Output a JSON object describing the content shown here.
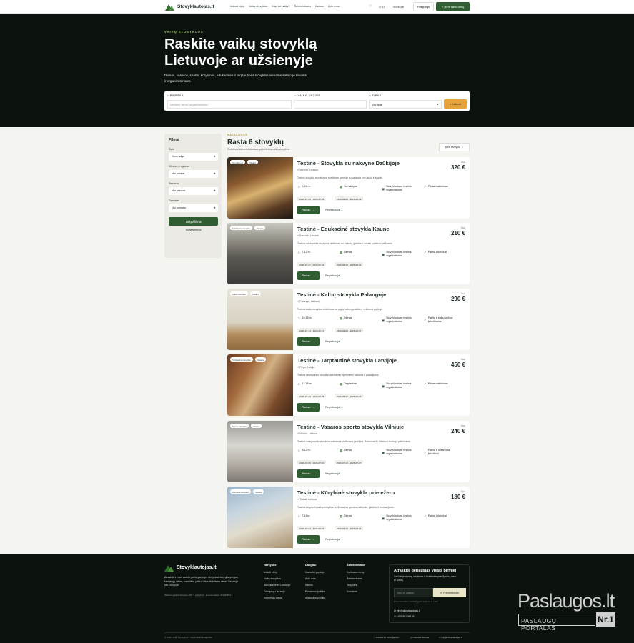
{
  "header": {
    "logo": "Stovyklautojas.lt",
    "nav": [
      "Ieškoti vietų",
      "Vaikų stovyklos",
      "Kaip tai veikia?",
      "Šeimininkams",
      "Kainos",
      "Apie mus"
    ],
    "lang": "LT",
    "search": "Ieškoti",
    "login": "Prisijungti",
    "add": "Įkelti savo vietą"
  },
  "hero": {
    "kicker": "VAIKŲ STOVYKLOS",
    "title": "Raskite vaikų stovyklą Lietuvoje ar užsienyje",
    "subtitle": "Dienos, vasaros, sporto, kūrybinės, edukacinės ir tarptautinės stovyklos viename kataloge tėvams ir organizatoriams.",
    "search": {
      "q_label": "PAIEŠKA",
      "q_placeholder": "Miestas, tema, organizatorius...",
      "age_label": "VAIKO AMŽIUS",
      "type_label": "TIPAS",
      "type_value": "Visi tipai",
      "button": "Ieškoti"
    }
  },
  "filters": {
    "title": "Filtrai",
    "groups": [
      {
        "label": "Šalis",
        "value": "Visos šalys"
      },
      {
        "label": "Miestas / regionas",
        "value": "Visi miestai"
      },
      {
        "label": "Sezonas",
        "value": "Visi sezonai"
      },
      {
        "label": "Formatas",
        "value": "Visi formatai"
      }
    ],
    "apply": "Taikyti filtrus",
    "clear": "Išvalyti filtrus"
  },
  "catalog": {
    "kicker": "KATALOGAS",
    "title": "Rasta 6 stovyklų",
    "subtitle": "Rodomos administratoriaus patvirtintos vaikų stovyklos.",
    "add_button": "Įkelti stovyklą",
    "from_label": "Nuo",
    "more_label": "Plačiau",
    "reg_label": "Registracija"
  },
  "camps": [
    {
      "title": "Testinė - Stovykla su nakvyne Dzūkijoje",
      "location": "Varėna, Lietuva",
      "desc": "Testinė stovykla su nakvyne skelbimas gamtoje su vakarais prie laužo ir žygiais.",
      "tags": [
        "Su nakvyne",
        "Vasara"
      ],
      "price": "320 €",
      "age": "9-14 m.",
      "format": "Su nakvyne",
      "org": "Stovyklautojas testinis organizatorius",
      "feature": "Pilnas maitinimas",
      "dates": [
        "2026-07-20 - 2026-07-26",
        "2026-08-03 - 2026-08-09"
      ]
    },
    {
      "title": "Testinė - Edukacinė stovykla Kaune",
      "location": "Kaunas, Lietuva",
      "desc": "Testinis edukacinės stovyklos skelbimas su mokslo, gamtos ir miesto pažinimo veiklomis.",
      "tags": [
        "Edukacinė stovykla",
        "Vasara"
      ],
      "price": "210 €",
      "age": "7-12 m.",
      "format": "Dienos",
      "org": "Stovyklautojas testinis organizatorius",
      "feature": "Patiria įsikeičiusi",
      "dates": [
        "2026-07-27 - 2026-07-31",
        "2026-08-10 - 2026-08-14"
      ]
    },
    {
      "title": "Testinė - Kalbų stovykla Palangoje",
      "location": "Palanga, Lietuva",
      "desc": "Testinis kalbų stovyklos skelbimas su anglų kalbos praktika ir veiklomis pajūryje.",
      "tags": [
        "Kalbų stovykla",
        "Vasara"
      ],
      "price": "290 €",
      "age": "10-15 m.",
      "format": "Dienos",
      "org": "Stovyklautojas testinis organizatorius",
      "feature": "Patiria ir kalbų veiklos įsikeičiusios",
      "dates": [
        "2026-07-13 - 2026-07-17",
        "2026-08-03 - 2026-08-07"
      ]
    },
    {
      "title": "Testinė - Tarptautinė stovykla Latvijoje",
      "location": "Ryga, Latvija",
      "desc": "Testinis tarptautinės stovyklos skelbimas vyresniems vaikams ir paaugliams.",
      "tags": [
        "Tarptautinė stovykla",
        "Vasara"
      ],
      "price": "450 €",
      "age": "12-16 m.",
      "format": "Tarptautinė",
      "org": "Stovyklautojas testinis organizatorius",
      "feature": "Pilnas maitinimas",
      "dates": [
        "2026-07-20 - 2026-07-26",
        "2026-08-17 - 2026-08-23"
      ]
    },
    {
      "title": "Testinė - Vasaros sporto stovykla Vilniuje",
      "location": "Vilnius, Lietuva",
      "desc": "Testinis vaikų sporto stovyklos skelbimas platformos peržiūrai. Rodomas tik dizaino ir funkcijų patikrinimui.",
      "tags": [
        "Sporto stovykla",
        "Vasara"
      ],
      "price": "240 €",
      "age": "8-13 m.",
      "format": "Dienos",
      "org": "Stovyklautojas testinis organizatorius",
      "feature": "Patiria ir užkandžiai įsikeičiusi",
      "dates": [
        "2026-07-06 - 2026-07-10",
        "2026-07-13 - 2026-07-17"
      ]
    },
    {
      "title": "Testinė - Kūrybinė stovykla prie ežero",
      "location": "Trakai, Lietuva",
      "desc": "Testinis kūrybinės vaikų stovyklos skelbimas su gamtos veiklomis, piešimu ir edukacijomis.",
      "tags": [
        "Kūrybinė stovykla",
        "Vasara"
      ],
      "price": "180 €",
      "age": "7-11 m.",
      "format": "Dienos",
      "org": "Stovyklautojas testinis organizatorius",
      "feature": "Patiria įsikeičiusi",
      "dates": [
        "2026-08-03 - 2026-08-07",
        "2026-08-10 - 2026-08-14"
      ]
    }
  ],
  "footer": {
    "logo": "Stovyklautojas.lt",
    "desc": "Atraskite ir rezervuokite poilsį gamtoje: stovyklavietes, glampingus, kempingų vietas, namelius, pirtis ir kitas išskirtines vietas Lietuvoje bei Europoje.",
    "small": "Platformą administruoja UAB \"7 prekybos\", įmonės kodas: 304435893.",
    "cols": [
      {
        "h": "Naršykite",
        "items": [
          "Ieškoti vietų",
          "Vaikų stovyklos",
          "Stovyklavietės Lietuvoje",
          "Glamping Lietuvoje",
          "Kempingų vietos"
        ]
      },
      {
        "h": "Daugiau",
        "items": [
          "Nameliai gamtoje",
          "Apie mus",
          "Kainos",
          "Privatumo politika",
          "Atšaukimo politika"
        ]
      },
      {
        "h": "Šeimininkams",
        "items": [
          "Kurti savo vietą",
          "Šeimininkams",
          "Taisyklės",
          "Kontaktai"
        ]
      }
    ],
    "box": {
      "title": "Atraskite geriausias vietas pirmiej",
      "body": "Gaukite įkvėpimą, naujienas ir išskirtinius pasiūlymus į savo el. paštą.",
      "email_placeholder": "Jūsų el. paštas",
      "subscribe": "Prenumeruoti",
      "note": "Prenumeruodami sutinkate gauti naujienas el. paštu.",
      "email": "info@stovyklautojas.lt",
      "phone": "+370 601 35126"
    },
    "copy": "© 2026 UAB \"7 prekybos\". Visos teisės saugomos.",
    "bottom": [
      "Sukurta su meile gamtai",
      "Lietuva ir Europa",
      "info@stovyklautojas.lt"
    ]
  },
  "watermark": {
    "top": "Paslaugos.lt",
    "bottom": "PASLAUGŲ PORTALAS",
    "badge": "Nr.1"
  }
}
